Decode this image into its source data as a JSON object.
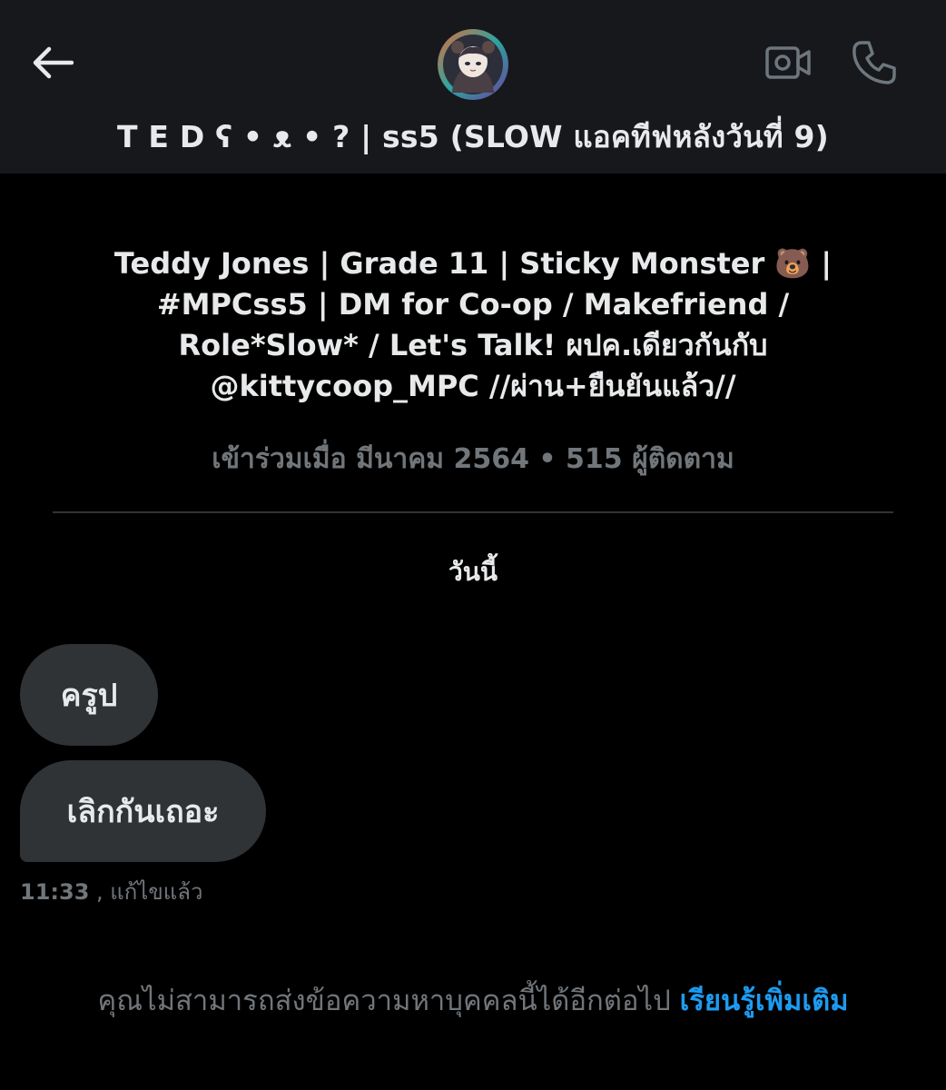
{
  "header": {
    "title": "T E D ʕ • ᴥ • ? | ss5 (SLOW แอคทีฟหลังวันที่ 9)",
    "back_icon": "arrow-left-icon",
    "video_icon": "video-camera-icon",
    "call_icon": "phone-icon"
  },
  "profile": {
    "bio_lines": [
      "Teddy Jones | Grade 11 | Sticky Monster 🐻 |",
      "#MPCss5 | DM for Co-op / Makefriend /",
      "Role*Slow* / Let's Talk! ผปค.เดียวกันกับ",
      "@kittycoop_MPC //ผ่าน+ยืนยันแล้ว//"
    ],
    "meta": "เข้าร่วมเมื่อ มีนาคม 2564 • 515 ผู้ติดตาม"
  },
  "conversation": {
    "date_separator": "วันนี้",
    "messages": [
      {
        "text": "ครูป"
      },
      {
        "text": "เลิกกันเถอะ"
      }
    ],
    "last_time": "11:33",
    "edited_label": " , แก้ไขแล้ว"
  },
  "footer": {
    "notice_text": "คุณไม่สามารถส่งข้อความหาบุคคลนี้ได้อีกต่อไป ",
    "learn_more": "เรียนรู้เพิ่มเติม"
  },
  "colors": {
    "background": "#000000",
    "header_bg": "#16181c",
    "bubble_bg": "#2f3336",
    "muted_text": "#71767b",
    "link": "#1d9bf0"
  }
}
